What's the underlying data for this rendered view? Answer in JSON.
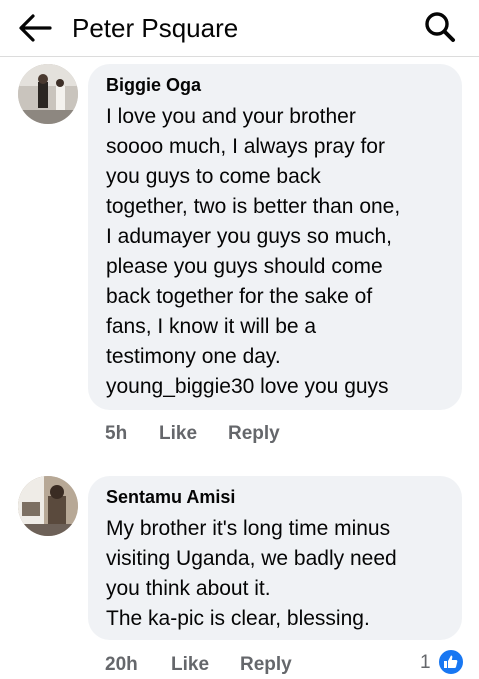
{
  "header": {
    "title": "Peter Psquare"
  },
  "comments": [
    {
      "author": "Biggie Oga",
      "text": "I love you and your brother\nsoooo much, I always pray for\nyou guys to come back\ntogether, two is better than one,\nI adumayer you guys so much,\nplease you guys should come\nback together for the sake of\nfans, I know it will be a\ntestimony one day.\nyoung_biggie30 love you guys",
      "time": "5h",
      "like_label": "Like",
      "reply_label": "Reply"
    },
    {
      "author": "Sentamu Amisi",
      "text": "My brother it's long time minus\nvisiting Uganda, we badly need\nyou think about it.\nThe ka-pic is clear, blessing.",
      "time": "20h",
      "like_label": "Like",
      "reply_label": "Reply",
      "reaction_count": "1"
    }
  ],
  "colors": {
    "bubble_bg": "#f0f2f5",
    "meta_text": "#65676b",
    "like_blue": "#1877f2"
  }
}
